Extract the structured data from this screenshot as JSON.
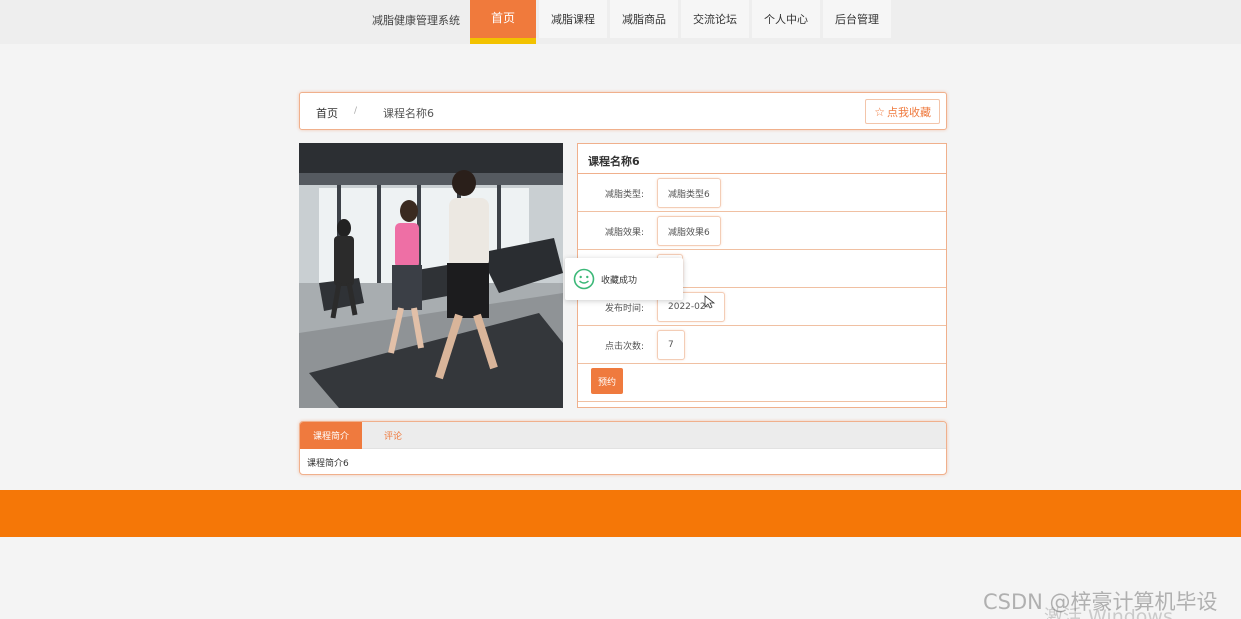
{
  "header": {
    "brand": "减脂健康管理系统",
    "nav": [
      "首页",
      "减脂课程",
      "减脂商品",
      "交流论坛",
      "个人中心",
      "后台管理"
    ],
    "active_index": 0
  },
  "breadcrumb": {
    "home": "首页",
    "separator": "/",
    "current": "课程名称6",
    "favorite_label": "点我收藏",
    "favorite_icon": "star-icon"
  },
  "image": {
    "alt_icon": "treadmill-photo"
  },
  "detail": {
    "title": "课程名称6",
    "rows": [
      {
        "label": "减脂类型:",
        "value": "减脂类型6"
      },
      {
        "label": "减脂效果:",
        "value": "减脂效果6"
      },
      {
        "label": "",
        "value": ""
      },
      {
        "label": "发布时间:",
        "value": "2022-02-"
      },
      {
        "label": "点击次数:",
        "value": "7"
      }
    ],
    "book_button": "预约"
  },
  "toast": {
    "text": "收藏成功",
    "icon": "smile-icon"
  },
  "tabs": {
    "items": [
      "课程简介",
      "评论"
    ],
    "active_index": 0,
    "content": "课程简介6"
  },
  "colors": {
    "accent": "#ef7a3e",
    "footer": "#f57707",
    "nav_underline": "#f2c200"
  },
  "watermark": {
    "csdn": "CSDN @梓豪计算机毕设",
    "windows": "激活 Windows"
  }
}
